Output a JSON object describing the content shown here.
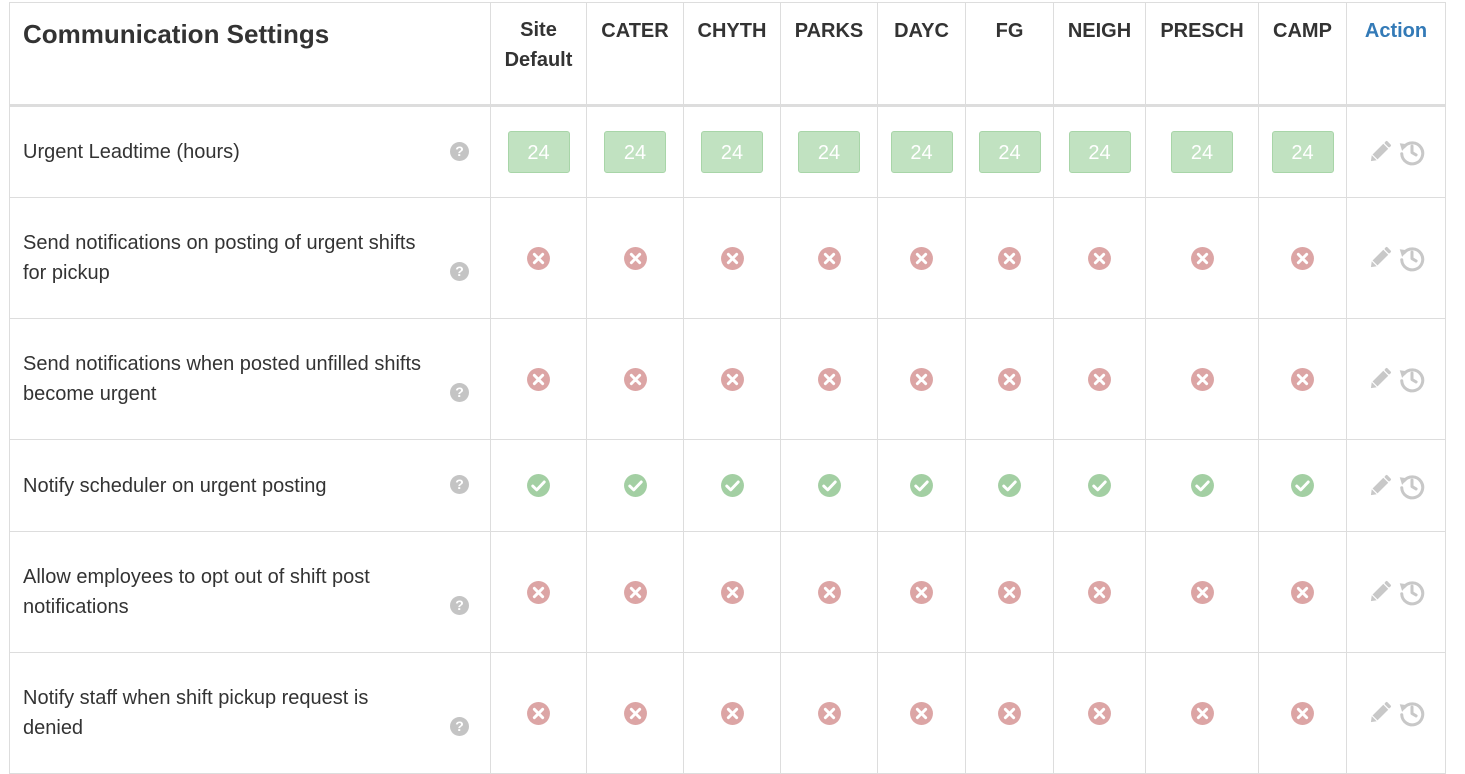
{
  "title": "Communication Settings",
  "columns": [
    {
      "label_line1": "Site",
      "label_line2": "Default"
    },
    {
      "label_line1": "CATER"
    },
    {
      "label_line1": "CHYTH"
    },
    {
      "label_line1": "PARKS"
    },
    {
      "label_line1": "DAYC"
    },
    {
      "label_line1": "FG"
    },
    {
      "label_line1": "NEIGH"
    },
    {
      "label_line1": "PRESCH"
    },
    {
      "label_line1": "CAMP"
    }
  ],
  "action_label": "Action",
  "help_glyph": "?",
  "rows": [
    {
      "label": "Urgent Leadtime (hours)",
      "kind": "number",
      "values": [
        "24",
        "24",
        "24",
        "24",
        "24",
        "24",
        "24",
        "24",
        "24"
      ]
    },
    {
      "label": "Send notifications on posting of urgent shifts for pickup",
      "kind": "bool",
      "values": [
        false,
        false,
        false,
        false,
        false,
        false,
        false,
        false,
        false
      ]
    },
    {
      "label": "Send notifications when posted unfilled shifts become urgent",
      "kind": "bool",
      "values": [
        false,
        false,
        false,
        false,
        false,
        false,
        false,
        false,
        false
      ]
    },
    {
      "label": "Notify scheduler on urgent posting",
      "kind": "bool",
      "values": [
        true,
        true,
        true,
        true,
        true,
        true,
        true,
        true,
        true
      ]
    },
    {
      "label": "Allow employees to opt out of shift post notifications",
      "kind": "bool",
      "values": [
        false,
        false,
        false,
        false,
        false,
        false,
        false,
        false,
        false
      ]
    },
    {
      "label": "Notify staff when shift pickup request is denied",
      "kind": "bool",
      "values": [
        false,
        false,
        false,
        false,
        false,
        false,
        false,
        false,
        false
      ]
    }
  ],
  "colors": {
    "check": "#a3cfa3",
    "cross": "#dca5a5",
    "badge_bg": "#c1e2c1",
    "action_link": "#337ab7",
    "action_icon": "#c8c8c8"
  },
  "icons": {
    "true": "check-circle-icon",
    "false": "times-circle-icon",
    "edit": "pencil-icon",
    "reset": "history-icon",
    "help": "question-circle-icon"
  }
}
